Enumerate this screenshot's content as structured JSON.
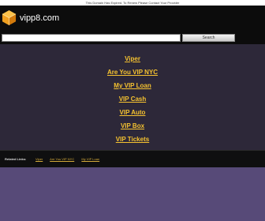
{
  "banner": {
    "text": "This Domain Has Expired. To Renew Please Contact Your Provider"
  },
  "header": {
    "logo_icon": "orange-cube-icon",
    "site_name": "vipp8.com"
  },
  "search": {
    "value": "",
    "placeholder": "",
    "button_label": "Search"
  },
  "links": [
    "Viper",
    "Are You VIP NYC",
    "My VIP Loan",
    "VIP Cash",
    "VIP Auto",
    "VIP Box",
    "VIP Tickets"
  ],
  "related": {
    "title": "Related Links:",
    "items": [
      "Viper",
      "Are You VIP NYC",
      "My VIP Loan"
    ]
  },
  "colors": {
    "link": "#f5c230",
    "content_bg": "#2d2839",
    "page_bg": "#574a78",
    "header_bg": "#0c0c0c",
    "logo": "#f0a020"
  }
}
